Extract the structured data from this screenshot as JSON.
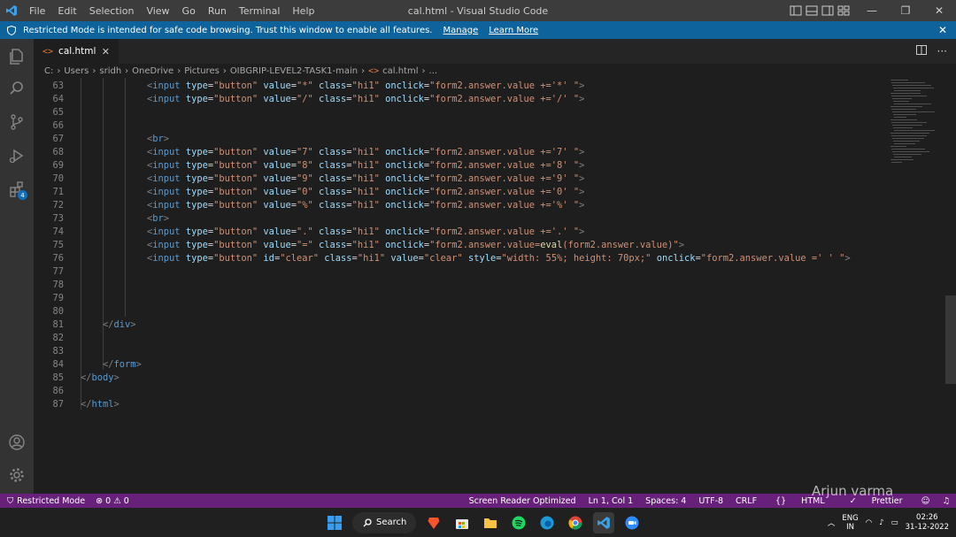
{
  "titlebar": {
    "menu": [
      "File",
      "Edit",
      "Selection",
      "View",
      "Go",
      "Run",
      "Terminal",
      "Help"
    ],
    "title": "cal.html - Visual Studio Code"
  },
  "banner": {
    "message": "Restricted Mode is intended for safe code browsing. Trust this window to enable all features.",
    "manage": "Manage",
    "learn_more": "Learn More"
  },
  "tab": {
    "label": "cal.html",
    "lang_icon": "<>",
    "close": "✕"
  },
  "breadcrumb": [
    "C:",
    "Users",
    "sridh",
    "OneDrive",
    "Pictures",
    "OIBGRIP-LEVEL2-TASK1-main",
    "cal.html",
    "..."
  ],
  "editor": {
    "lines": [
      {
        "n": "63",
        "tokens": [
          [
            "tg",
            "<"
          ],
          [
            "tn",
            "input"
          ],
          [
            "t",
            " "
          ],
          [
            "at",
            "type"
          ],
          [
            "t",
            "="
          ],
          [
            "st",
            "\"button\""
          ],
          [
            "t",
            " "
          ],
          [
            "at",
            "value"
          ],
          [
            "t",
            "="
          ],
          [
            "st",
            "\"*\""
          ],
          [
            "t",
            " "
          ],
          [
            "at",
            "class"
          ],
          [
            "t",
            "="
          ],
          [
            "st",
            "\"hi1\""
          ],
          [
            "t",
            " "
          ],
          [
            "at",
            "onclick"
          ],
          [
            "t",
            "="
          ],
          [
            "st",
            "\"form2.answer.value +='*' \""
          ],
          [
            "tg",
            ">"
          ]
        ],
        "indent": 3
      },
      {
        "n": "64",
        "tokens": [
          [
            "tg",
            "<"
          ],
          [
            "tn",
            "input"
          ],
          [
            "t",
            " "
          ],
          [
            "at",
            "type"
          ],
          [
            "t",
            "="
          ],
          [
            "st",
            "\"button\""
          ],
          [
            "t",
            " "
          ],
          [
            "at",
            "value"
          ],
          [
            "t",
            "="
          ],
          [
            "st",
            "\"/\""
          ],
          [
            "t",
            " "
          ],
          [
            "at",
            "class"
          ],
          [
            "t",
            "="
          ],
          [
            "st",
            "\"hi1\""
          ],
          [
            "t",
            " "
          ],
          [
            "at",
            "onclick"
          ],
          [
            "t",
            "="
          ],
          [
            "st",
            "\"form2.answer.value +='/' \""
          ],
          [
            "tg",
            ">"
          ]
        ],
        "indent": 3
      },
      {
        "n": "65",
        "tokens": [],
        "indent": 0
      },
      {
        "n": "66",
        "tokens": [],
        "indent": 0
      },
      {
        "n": "67",
        "tokens": [
          [
            "tg",
            "<"
          ],
          [
            "tn",
            "br"
          ],
          [
            "tg",
            ">"
          ]
        ],
        "indent": 3
      },
      {
        "n": "68",
        "tokens": [
          [
            "tg",
            "<"
          ],
          [
            "tn",
            "input"
          ],
          [
            "t",
            " "
          ],
          [
            "at",
            "type"
          ],
          [
            "t",
            "="
          ],
          [
            "st",
            "\"button\""
          ],
          [
            "t",
            " "
          ],
          [
            "at",
            "value"
          ],
          [
            "t",
            "="
          ],
          [
            "st",
            "\"7\""
          ],
          [
            "t",
            " "
          ],
          [
            "at",
            "class"
          ],
          [
            "t",
            "="
          ],
          [
            "st",
            "\"hi1\""
          ],
          [
            "t",
            " "
          ],
          [
            "at",
            "onclick"
          ],
          [
            "t",
            "="
          ],
          [
            "st",
            "\"form2.answer.value +='7' \""
          ],
          [
            "tg",
            ">"
          ]
        ],
        "indent": 3
      },
      {
        "n": "69",
        "tokens": [
          [
            "tg",
            "<"
          ],
          [
            "tn",
            "input"
          ],
          [
            "t",
            " "
          ],
          [
            "at",
            "type"
          ],
          [
            "t",
            "="
          ],
          [
            "st",
            "\"button\""
          ],
          [
            "t",
            " "
          ],
          [
            "at",
            "value"
          ],
          [
            "t",
            "="
          ],
          [
            "st",
            "\"8\""
          ],
          [
            "t",
            " "
          ],
          [
            "at",
            "class"
          ],
          [
            "t",
            "="
          ],
          [
            "st",
            "\"hi1\""
          ],
          [
            "t",
            " "
          ],
          [
            "at",
            "onclick"
          ],
          [
            "t",
            "="
          ],
          [
            "st",
            "\"form2.answer.value +='8' \""
          ],
          [
            "tg",
            ">"
          ]
        ],
        "indent": 3
      },
      {
        "n": "70",
        "tokens": [
          [
            "tg",
            "<"
          ],
          [
            "tn",
            "input"
          ],
          [
            "t",
            " "
          ],
          [
            "at",
            "type"
          ],
          [
            "t",
            "="
          ],
          [
            "st",
            "\"button\""
          ],
          [
            "t",
            " "
          ],
          [
            "at",
            "value"
          ],
          [
            "t",
            "="
          ],
          [
            "st",
            "\"9\""
          ],
          [
            "t",
            " "
          ],
          [
            "at",
            "class"
          ],
          [
            "t",
            "="
          ],
          [
            "st",
            "\"hi1\""
          ],
          [
            "t",
            " "
          ],
          [
            "at",
            "onclick"
          ],
          [
            "t",
            "="
          ],
          [
            "st",
            "\"form2.answer.value +='9' \""
          ],
          [
            "tg",
            ">"
          ]
        ],
        "indent": 3
      },
      {
        "n": "71",
        "tokens": [
          [
            "tg",
            "<"
          ],
          [
            "tn",
            "input"
          ],
          [
            "t",
            " "
          ],
          [
            "at",
            "type"
          ],
          [
            "t",
            "="
          ],
          [
            "st",
            "\"button\""
          ],
          [
            "t",
            " "
          ],
          [
            "at",
            "value"
          ],
          [
            "t",
            "="
          ],
          [
            "st",
            "\"0\""
          ],
          [
            "t",
            " "
          ],
          [
            "at",
            "class"
          ],
          [
            "t",
            "="
          ],
          [
            "st",
            "\"hi1\""
          ],
          [
            "t",
            " "
          ],
          [
            "at",
            "onclick"
          ],
          [
            "t",
            "="
          ],
          [
            "st",
            "\"form2.answer.value +='0' \""
          ],
          [
            "tg",
            ">"
          ]
        ],
        "indent": 3
      },
      {
        "n": "72",
        "tokens": [
          [
            "tg",
            "<"
          ],
          [
            "tn",
            "input"
          ],
          [
            "t",
            " "
          ],
          [
            "at",
            "type"
          ],
          [
            "t",
            "="
          ],
          [
            "st",
            "\"button\""
          ],
          [
            "t",
            " "
          ],
          [
            "at",
            "value"
          ],
          [
            "t",
            "="
          ],
          [
            "st",
            "\"%\""
          ],
          [
            "t",
            " "
          ],
          [
            "at",
            "class"
          ],
          [
            "t",
            "="
          ],
          [
            "st",
            "\"hi1\""
          ],
          [
            "t",
            " "
          ],
          [
            "at",
            "onclick"
          ],
          [
            "t",
            "="
          ],
          [
            "st",
            "\"form2.answer.value +='%' \""
          ],
          [
            "tg",
            ">"
          ]
        ],
        "indent": 3
      },
      {
        "n": "73",
        "tokens": [
          [
            "tg",
            "<"
          ],
          [
            "tn",
            "br"
          ],
          [
            "tg",
            ">"
          ]
        ],
        "indent": 3
      },
      {
        "n": "74",
        "tokens": [
          [
            "tg",
            "<"
          ],
          [
            "tn",
            "input"
          ],
          [
            "t",
            " "
          ],
          [
            "at",
            "type"
          ],
          [
            "t",
            "="
          ],
          [
            "st",
            "\"button\""
          ],
          [
            "t",
            " "
          ],
          [
            "at",
            "value"
          ],
          [
            "t",
            "="
          ],
          [
            "st",
            "\".\""
          ],
          [
            "t",
            " "
          ],
          [
            "at",
            "class"
          ],
          [
            "t",
            "="
          ],
          [
            "st",
            "\"hi1\""
          ],
          [
            "t",
            " "
          ],
          [
            "at",
            "onclick"
          ],
          [
            "t",
            "="
          ],
          [
            "st",
            "\"form2.answer.value +='.' \""
          ],
          [
            "tg",
            ">"
          ]
        ],
        "indent": 3
      },
      {
        "n": "75",
        "tokens": [
          [
            "tg",
            "<"
          ],
          [
            "tn",
            "input"
          ],
          [
            "t",
            " "
          ],
          [
            "at",
            "type"
          ],
          [
            "t",
            "="
          ],
          [
            "st",
            "\"button\""
          ],
          [
            "t",
            " "
          ],
          [
            "at",
            "value"
          ],
          [
            "t",
            "="
          ],
          [
            "st",
            "\"=\""
          ],
          [
            "t",
            " "
          ],
          [
            "at",
            "class"
          ],
          [
            "t",
            "="
          ],
          [
            "st",
            "\"hi1\""
          ],
          [
            "t",
            " "
          ],
          [
            "at",
            "onclick"
          ],
          [
            "t",
            "="
          ],
          [
            "st",
            "\"form2.answer.value="
          ],
          [
            "ev",
            "eval"
          ],
          [
            "st",
            "(form2.answer.value)\""
          ],
          [
            "tg",
            ">"
          ]
        ],
        "indent": 3
      },
      {
        "n": "76",
        "tokens": [
          [
            "tg",
            "<"
          ],
          [
            "tn",
            "input"
          ],
          [
            "t",
            " "
          ],
          [
            "at",
            "type"
          ],
          [
            "t",
            "="
          ],
          [
            "st",
            "\"button\""
          ],
          [
            "t",
            " "
          ],
          [
            "at",
            "id"
          ],
          [
            "t",
            "="
          ],
          [
            "st",
            "\"clear\""
          ],
          [
            "t",
            " "
          ],
          [
            "at",
            "class"
          ],
          [
            "t",
            "="
          ],
          [
            "st",
            "\"hi1\""
          ],
          [
            "t",
            " "
          ],
          [
            "at",
            "value"
          ],
          [
            "t",
            "="
          ],
          [
            "st",
            "\"clear\""
          ],
          [
            "t",
            " "
          ],
          [
            "at",
            "style"
          ],
          [
            "t",
            "="
          ],
          [
            "st",
            "\"width: 55%; height: 70px;\""
          ],
          [
            "t",
            " "
          ],
          [
            "at",
            "onclick"
          ],
          [
            "t",
            "="
          ],
          [
            "st",
            "\"form2.answer.value =' ' \""
          ],
          [
            "tg",
            ">"
          ]
        ],
        "indent": 3
      },
      {
        "n": "77",
        "tokens": [],
        "indent": 0
      },
      {
        "n": "78",
        "tokens": [],
        "indent": 0
      },
      {
        "n": "79",
        "tokens": [],
        "indent": 0
      },
      {
        "n": "80",
        "tokens": [],
        "indent": 0
      },
      {
        "n": "81",
        "tokens": [
          [
            "tg",
            "</"
          ],
          [
            "tn",
            "div"
          ],
          [
            "tg",
            ">"
          ]
        ],
        "indent": 1
      },
      {
        "n": "82",
        "tokens": [],
        "indent": 0
      },
      {
        "n": "83",
        "tokens": [],
        "indent": 0
      },
      {
        "n": "84",
        "tokens": [
          [
            "tg",
            "</"
          ],
          [
            "tn",
            "form"
          ],
          [
            "tg",
            ">"
          ]
        ],
        "indent": 1
      },
      {
        "n": "85",
        "tokens": [
          [
            "tg",
            "</"
          ],
          [
            "tn",
            "body"
          ],
          [
            "tg",
            ">"
          ]
        ],
        "indent": 0
      },
      {
        "n": "86",
        "tokens": [],
        "indent": 0
      },
      {
        "n": "87",
        "tokens": [
          [
            "tg",
            "</"
          ],
          [
            "tn",
            "html"
          ],
          [
            "tg",
            ">"
          ]
        ],
        "indent": 0
      }
    ]
  },
  "statusbar": {
    "restricted": "Restricted Mode",
    "errors": "0",
    "warnings": "0",
    "screen_reader": "Screen Reader Optimized",
    "position": "Ln 1, Col 1",
    "spaces": "Spaces: 4",
    "encoding": "UTF-8",
    "eol": "CRLF",
    "language": "HTML",
    "prettier": "Prettier"
  },
  "watermark": {
    "name": "Arjun varma"
  },
  "taskbar": {
    "search": "Search",
    "lang_top": "ENG",
    "lang_bottom": "IN",
    "time": "02:26",
    "date": "31-12-2022"
  },
  "colors": {
    "accent": "#0e639c",
    "status": "#68217a",
    "editor_bg": "#1e1e1e"
  },
  "activity_badge": "4"
}
